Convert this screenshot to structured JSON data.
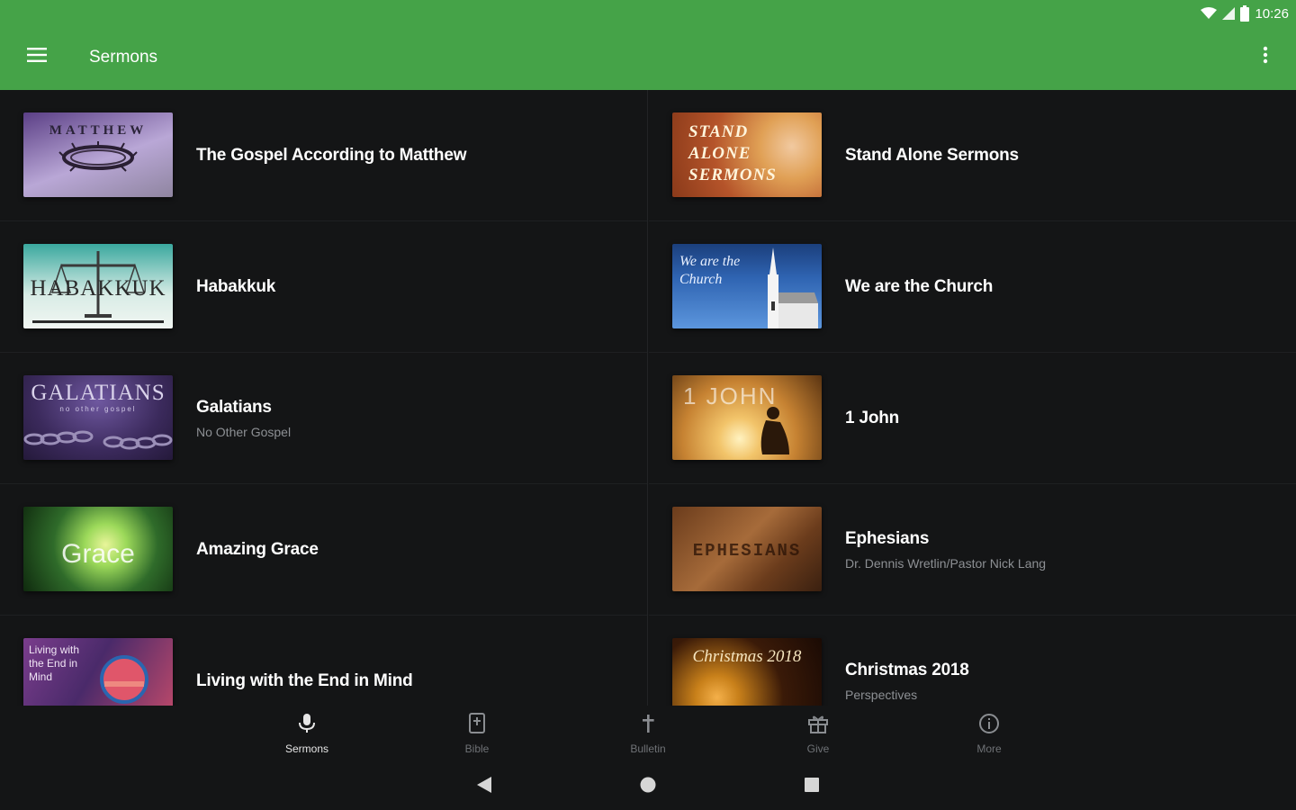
{
  "status_bar": {
    "time": "10:26",
    "wifi_icon": "wifi-icon",
    "signal_icon": "signal-icon",
    "battery_icon": "battery-icon"
  },
  "app_bar": {
    "title": "Sermons",
    "menu_icon": "menu-icon",
    "overflow_icon": "more-vert-icon",
    "color": "#45a348"
  },
  "series": [
    {
      "title": "The Gospel According to Matthew",
      "subtitle": "",
      "thumb_text": "MATTHEW",
      "colors": [
        "#5b3f86",
        "#b9a7d6",
        "#8f85a0"
      ]
    },
    {
      "title": "Stand Alone Sermons",
      "subtitle": "",
      "thumb_text": "STAND ALONE SERMONS",
      "colors": [
        "#b5542a",
        "#e0a055",
        "#8a3a1a"
      ]
    },
    {
      "title": "Habakkuk",
      "subtitle": "",
      "thumb_text": "HABAKKUK",
      "colors": [
        "#3aa89e",
        "#d8ece6",
        "#f1f6f2"
      ]
    },
    {
      "title": "We are the Church",
      "subtitle": "",
      "thumb_text": "We are the Church",
      "colors": [
        "#2f64b2",
        "#5c96dd",
        "#1b3f7c"
      ]
    },
    {
      "title": "Galatians",
      "subtitle": "No Other Gospel",
      "thumb_text": "GALATIANS",
      "thumb_sub": "no other gospel",
      "colors": [
        "#3b2a5c",
        "#6f58a0",
        "#24193a"
      ]
    },
    {
      "title": "1 John",
      "subtitle": "",
      "thumb_text": "1 JOHN",
      "colors": [
        "#f2c46a",
        "#c68232",
        "#5a3412"
      ]
    },
    {
      "title": "Amazing Grace",
      "subtitle": "",
      "thumb_text": "Grace",
      "colors": [
        "#2f6b2a",
        "#9cd95a",
        "#0f2a0e"
      ]
    },
    {
      "title": "Ephesians",
      "subtitle": "Dr. Dennis Wretlin/Pastor Nick Lang",
      "thumb_text": "EPHESIANS",
      "colors": [
        "#6b3c1c",
        "#a66b3a",
        "#3a2010"
      ]
    },
    {
      "title": "Living with the End in Mind",
      "subtitle": "",
      "thumb_text": "Living with the End in Mind",
      "colors": [
        "#7a3d8c",
        "#c04a6a",
        "#4a2a6a"
      ]
    },
    {
      "title": "Christmas 2018",
      "subtitle": "Perspectives",
      "thumb_text": "Christmas 2018",
      "colors": [
        "#3a1a08",
        "#c8801a",
        "#1a0a04"
      ]
    }
  ],
  "bottom_nav": [
    {
      "label": "Sermons",
      "icon": "microphone-icon",
      "active": true
    },
    {
      "label": "Bible",
      "icon": "bible-icon",
      "active": false
    },
    {
      "label": "Bulletin",
      "icon": "cross-icon",
      "active": false
    },
    {
      "label": "Give",
      "icon": "gift-icon",
      "active": false
    },
    {
      "label": "More",
      "icon": "info-icon",
      "active": false
    }
  ],
  "system_nav": {
    "back_icon": "back-triangle-icon",
    "home_icon": "home-circle-icon",
    "recents_icon": "recents-square-icon"
  }
}
